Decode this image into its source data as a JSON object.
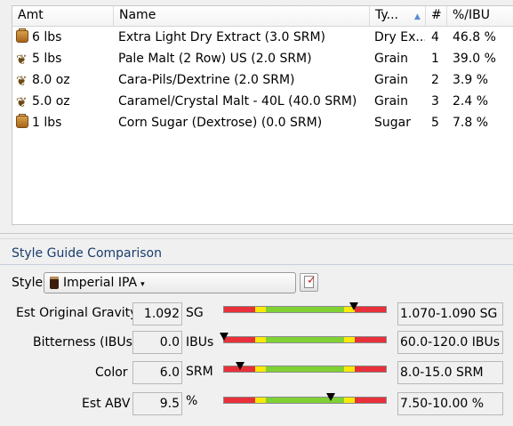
{
  "table": {
    "columns": {
      "amt": "Amt",
      "name": "Name",
      "type": "Ty...",
      "num": "#",
      "ibu": "%/IBU"
    },
    "rows": [
      {
        "icon": "extract-icon",
        "amt": "6 lbs",
        "name": "Extra Light Dry Extract (3.0 SRM)",
        "type": "Dry Ex...",
        "num": "4",
        "pct": "46.8 %"
      },
      {
        "icon": "grain-icon",
        "amt": "5 lbs",
        "name": "Pale Malt (2 Row) US (2.0 SRM)",
        "type": "Grain",
        "num": "1",
        "pct": "39.0 %"
      },
      {
        "icon": "grain-icon",
        "amt": "8.0 oz",
        "name": "Cara-Pils/Dextrine (2.0 SRM)",
        "type": "Grain",
        "num": "2",
        "pct": "3.9 %"
      },
      {
        "icon": "grain-icon",
        "amt": "5.0 oz",
        "name": "Caramel/Crystal Malt - 40L (40.0 SRM)",
        "type": "Grain",
        "num": "3",
        "pct": "2.4 %"
      },
      {
        "icon": "extract-icon",
        "amt": "1 lbs",
        "name": "Corn Sugar (Dextrose) (0.0 SRM)",
        "type": "Sugar",
        "num": "5",
        "pct": "7.8 %"
      }
    ]
  },
  "style_guide": {
    "title": "Style Guide Comparison",
    "style_label": "Style",
    "style_value": "Imperial IPA",
    "dropdown_arrow": "▾",
    "colors": {
      "red": "#e8303a",
      "yellow": "#f7ea0a",
      "green": "#7fd134",
      "marker": "#000000"
    },
    "metrics": [
      {
        "label": "Est Original Gravity",
        "value": "1.092",
        "unit": "SG",
        "range": "1.070-1.090 SG",
        "marker_fraction": 0.8
      },
      {
        "label": "Bitterness (IBUs)",
        "value": "0.0",
        "unit": "IBUs",
        "range": "60.0-120.0 IBUs",
        "marker_fraction": 0.0
      },
      {
        "label": "Color",
        "value": "6.0",
        "unit": "SRM",
        "range": "8.0-15.0 SRM",
        "marker_fraction": 0.1
      },
      {
        "label": "Est ABV",
        "value": "9.5",
        "unit": "%",
        "range": "7.50-10.00 %",
        "marker_fraction": 0.66
      }
    ]
  }
}
